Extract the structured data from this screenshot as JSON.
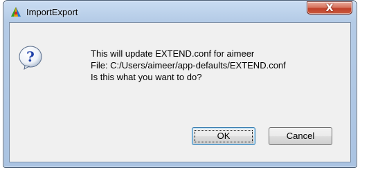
{
  "window": {
    "title": "ImportExport",
    "close_label": "X"
  },
  "message": {
    "line1": "This will update EXTEND.conf for aimeer",
    "line2": "File: C:/Users/aimeer/app-defaults/EXTEND.conf",
    "line3": "Is this what you want to do?"
  },
  "buttons": {
    "ok_label": "OK",
    "cancel_label": "Cancel"
  },
  "icons": {
    "app": "app-logo-icon",
    "dialog": "question-icon"
  }
}
